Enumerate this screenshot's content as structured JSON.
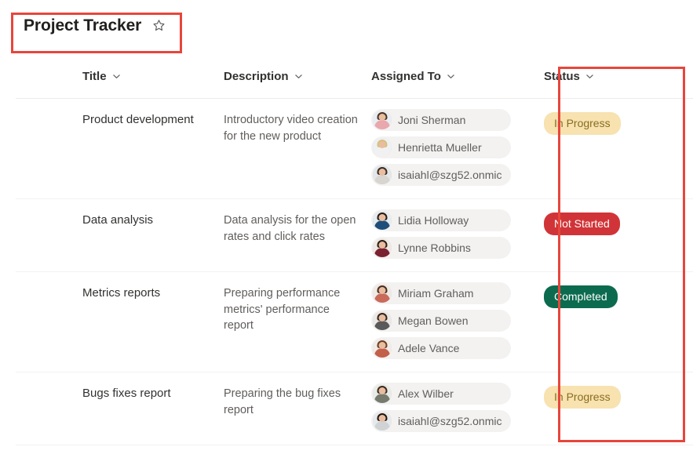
{
  "header": {
    "title": "Project Tracker",
    "favorite_icon": "star-outline-icon"
  },
  "table": {
    "columns": [
      {
        "label": "Title",
        "sort_icon": "chevron-down-icon"
      },
      {
        "label": "Description",
        "sort_icon": "chevron-down-icon"
      },
      {
        "label": "Assigned To",
        "sort_icon": "chevron-down-icon"
      },
      {
        "label": "Status",
        "sort_icon": "chevron-down-icon"
      }
    ],
    "rows": [
      {
        "title": "Product development",
        "description": "Introductory video creation for the new product",
        "assigned_to": [
          {
            "name": "Joni Sherman"
          },
          {
            "name": "Henrietta Mueller"
          },
          {
            "name": "isaiahl@szg52.onmic"
          }
        ],
        "status": "In Progress"
      },
      {
        "title": "Data analysis",
        "description": "Data analysis for the open rates and click rates",
        "assigned_to": [
          {
            "name": "Lidia Holloway"
          },
          {
            "name": "Lynne Robbins"
          }
        ],
        "status": "Not Started"
      },
      {
        "title": "Metrics reports",
        "description": "Preparing performance metrics' performance report",
        "assigned_to": [
          {
            "name": "Miriam Graham"
          },
          {
            "name": "Megan Bowen"
          },
          {
            "name": "Adele Vance"
          }
        ],
        "status": "Completed"
      },
      {
        "title": "Bugs fixes report",
        "description": "Preparing the bug fixes report",
        "assigned_to": [
          {
            "name": "Alex Wilber"
          },
          {
            "name": "isaiahl@szg52.onmic"
          }
        ],
        "status": "In Progress"
      }
    ]
  },
  "status_styles": {
    "In Progress": {
      "background": "#f7e2b0",
      "color": "#8a6d1f"
    },
    "Not Started": {
      "background": "#d13438",
      "color": "#ffffff"
    },
    "Completed": {
      "background": "#0c6b4f",
      "color": "#ffffff"
    }
  },
  "annotations": [
    {
      "name": "title-highlight",
      "color": "#e8453c"
    },
    {
      "name": "status-highlight",
      "color": "#e8453c"
    }
  ]
}
